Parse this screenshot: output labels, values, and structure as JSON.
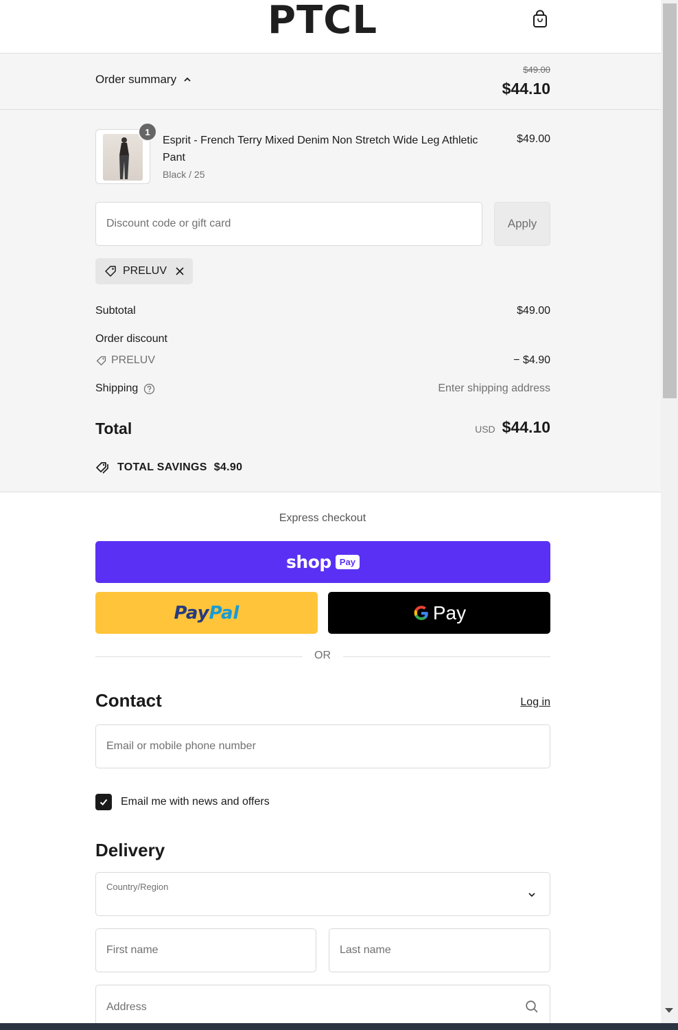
{
  "header": {
    "logo": "PTCL",
    "cart_icon": "shopping-bag-icon"
  },
  "summary": {
    "toggle_label": "Order summary",
    "original_price": "$49.00",
    "total": "$44.10",
    "product": {
      "quantity": "1",
      "name": "Esprit - French Terry Mixed Denim Non Stretch Wide Leg Athletic Pant",
      "variant": "Black / 25",
      "price": "$49.00"
    },
    "discount": {
      "placeholder": "Discount code or gift card",
      "value": "",
      "apply_label": "Apply",
      "applied_code": "PRELUV"
    },
    "rows": {
      "subtotal_label": "Subtotal",
      "subtotal_value": "$49.00",
      "order_discount_label": "Order discount",
      "discount_code": "PRELUV",
      "discount_value": "− $4.90",
      "shipping_label": "Shipping",
      "shipping_value": "Enter shipping address",
      "total_label": "Total",
      "currency": "USD",
      "total_value": "$44.10"
    },
    "savings": {
      "label": "TOTAL SAVINGS",
      "value": "$4.90"
    }
  },
  "express": {
    "label": "Express checkout",
    "shop_word": "shop",
    "shop_badge": "Pay",
    "paypal_pay": "Pay",
    "paypal_pal": "Pal",
    "gpay_word": "Pay",
    "or_text": "OR"
  },
  "contact": {
    "heading": "Contact",
    "login_label": "Log in",
    "email_placeholder": "Email or mobile phone number",
    "newsletter_label": "Email me with news and offers",
    "newsletter_checked": true
  },
  "delivery": {
    "heading": "Delivery",
    "country_label": "Country/Region",
    "country_value": "",
    "first_name_placeholder": "First name",
    "last_name_placeholder": "Last name",
    "address_placeholder": "Address"
  },
  "colors": {
    "shop_pay": "#5a31f4",
    "paypal": "#ffc439",
    "paypal_dark": "#253b80",
    "paypal_light": "#179bd7",
    "gpay": "#000000"
  }
}
